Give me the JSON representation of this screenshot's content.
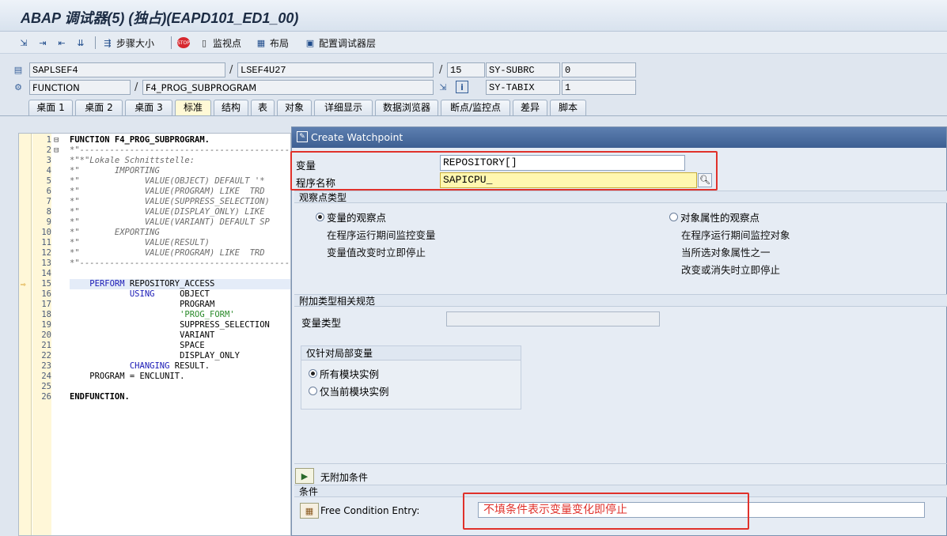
{
  "window": {
    "title": "ABAP 调试器(5) (独占)(EAPD101_ED1_00)"
  },
  "toolbar": {
    "step_size": "步骤大小",
    "watchpoint": "监视点",
    "layout": "布局",
    "configure_layers": "配置调试器层"
  },
  "info": {
    "program": "SAPLSEF4",
    "include": "LSEF4U27",
    "line": "15",
    "subrc_label": "SY-SUBRC",
    "subrc_value": "0",
    "event_type": "FUNCTION",
    "event": "F4_PROG_SUBPROGRAM",
    "tabix_label": "SY-TABIX",
    "tabix_value": "1"
  },
  "tabs": [
    "桌面 1",
    "桌面 2",
    "桌面 3",
    "标准",
    "结构",
    "表",
    "对象",
    "详细显示",
    "数据浏览器",
    "断点/监控点",
    "差异",
    "脚本"
  ],
  "active_tab_index": 3,
  "code": [
    {
      "n": "1",
      "fold": "⊟",
      "t": "FUNCTION F4_PROG_SUBPROGRAM.",
      "cls": "c-bold"
    },
    {
      "n": "2",
      "fold": "⊟",
      "t": "*\"-----------------------------------------------",
      "cls": "c-comment"
    },
    {
      "n": "3",
      "fold": "",
      "t": "*\"*\"Lokale Schnittstelle:",
      "cls": "c-comment"
    },
    {
      "n": "4",
      "fold": "",
      "t": "*\"       IMPORTING",
      "cls": "c-comment"
    },
    {
      "n": "5",
      "fold": "",
      "t": "*\"             VALUE(OBJECT) DEFAULT '*",
      "cls": "c-comment"
    },
    {
      "n": "6",
      "fold": "",
      "t": "*\"             VALUE(PROGRAM) LIKE  TRD",
      "cls": "c-comment"
    },
    {
      "n": "7",
      "fold": "",
      "t": "*\"             VALUE(SUPPRESS_SELECTION)",
      "cls": "c-comment"
    },
    {
      "n": "8",
      "fold": "",
      "t": "*\"             VALUE(DISPLAY_ONLY) LIKE",
      "cls": "c-comment"
    },
    {
      "n": "9",
      "fold": "",
      "t": "*\"             VALUE(VARIANT) DEFAULT SP",
      "cls": "c-comment"
    },
    {
      "n": "10",
      "fold": "",
      "t": "*\"       EXPORTING",
      "cls": "c-comment"
    },
    {
      "n": "11",
      "fold": "",
      "t": "*\"             VALUE(RESULT)",
      "cls": "c-comment"
    },
    {
      "n": "12",
      "fold": "",
      "t": "*\"             VALUE(PROGRAM) LIKE  TRD",
      "cls": "c-comment"
    },
    {
      "n": "13",
      "fold": "",
      "t": "*\"-----------------------------------------------",
      "cls": "c-comment"
    },
    {
      "n": "14",
      "fold": "",
      "t": "",
      "cls": ""
    },
    {
      "n": "15",
      "fold": "",
      "t": "    PERFORM REPOSITORY_ACCESS",
      "cls": "",
      "kw": "PERFORM",
      "arrow": true
    },
    {
      "n": "16",
      "fold": "",
      "t": "            USING     OBJECT",
      "cls": "",
      "kw": "USING"
    },
    {
      "n": "17",
      "fold": "",
      "t": "                      PROGRAM",
      "cls": ""
    },
    {
      "n": "18",
      "fold": "",
      "t": "                      'PROG_FORM'",
      "cls": "c-str"
    },
    {
      "n": "19",
      "fold": "",
      "t": "                      SUPPRESS_SELECTION",
      "cls": ""
    },
    {
      "n": "20",
      "fold": "",
      "t": "                      VARIANT",
      "cls": ""
    },
    {
      "n": "21",
      "fold": "",
      "t": "                      SPACE",
      "cls": ""
    },
    {
      "n": "22",
      "fold": "",
      "t": "                      DISPLAY_ONLY",
      "cls": ""
    },
    {
      "n": "23",
      "fold": "",
      "t": "            CHANGING RESULT.",
      "cls": "",
      "kw": "CHANGING"
    },
    {
      "n": "24",
      "fold": "",
      "t": "    PROGRAM = ENCLUNIT.",
      "cls": ""
    },
    {
      "n": "25",
      "fold": "",
      "t": "",
      "cls": ""
    },
    {
      "n": "26",
      "fold": "",
      "t": "ENDFUNCTION.",
      "cls": "c-bold"
    }
  ],
  "dialog": {
    "title": "Create Watchpoint",
    "variable_label": "变量",
    "variable_value": "REPOSITORY[]",
    "program_label": "程序名称",
    "program_value": "SAPICPU_",
    "wp_type_head": "观察点类型",
    "radio_var": "变量的观察点",
    "radio_var_desc1": "在程序运行期间监控变量",
    "radio_var_desc2": "变量值改变时立即停止",
    "radio_obj": "对象属性的观察点",
    "radio_obj_desc1": "在程序运行期间监控对象",
    "radio_obj_desc2": "当所选对象属性之一",
    "radio_obj_desc3": "改变或消失时立即停止",
    "extra_head": "附加类型相关规范",
    "var_type_label": "变量类型",
    "var_type_value": "",
    "local_head": "仅针对局部变量",
    "radio_all_inst": "所有模块实例",
    "radio_cur_inst": "仅当前模块实例",
    "no_cond": "无附加条件",
    "cond_head": "条件",
    "free_cond_label": "Free Condition Entry:",
    "free_cond_value": "不填条件表示变量变化即停止"
  }
}
